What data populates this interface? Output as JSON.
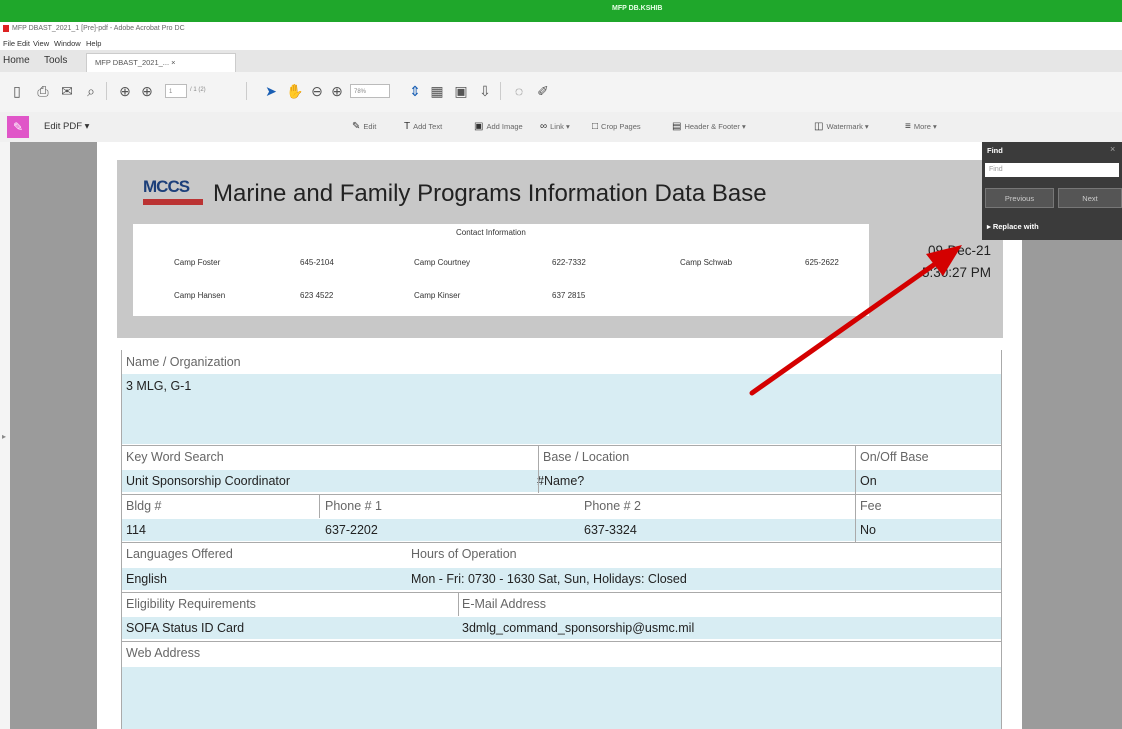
{
  "window": {
    "title_bar_text": "MFP DB.KSHIB",
    "app_title": "MFP DBAST_2021_1 [Pre]-pdf - Adobe Acrobat Pro DC"
  },
  "menu": [
    "File",
    "Edit",
    "View",
    "Window",
    "Help"
  ],
  "tabs": {
    "home": "Home",
    "tools": "Tools",
    "document": "MFP DBAST_2021_... ×"
  },
  "toolbar": {
    "page_box": "1",
    "page_total": "/ 1 (2)",
    "zoom": "78%"
  },
  "edit_pdf": {
    "label": "Edit PDF ▾",
    "tools": [
      {
        "icon": "✎",
        "label": "Edit"
      },
      {
        "icon": "T",
        "label": "Add Text"
      },
      {
        "icon": "▣",
        "label": "Add Image"
      },
      {
        "icon": "∞",
        "label": "Link ▾"
      },
      {
        "icon": "□",
        "label": "Crop Pages"
      },
      {
        "icon": "▤",
        "label": "Header & Footer ▾"
      },
      {
        "icon": "◫",
        "label": "Watermark ▾"
      },
      {
        "icon": "≡",
        "label": "More ▾"
      }
    ]
  },
  "find_panel": {
    "title": "Find",
    "close": "×",
    "placeholder": "Find",
    "previous": "Previous",
    "next": "Next",
    "replace_with": "▸ Replace with"
  },
  "form": {
    "logo_text": "MCCS",
    "title": "Marine and Family Programs Information Data Base",
    "date": "09-Dec-21",
    "time": "5:30:27 PM",
    "contact_title": "Contact Information",
    "contacts": [
      {
        "name": "Camp Foster",
        "phone": "645-2104"
      },
      {
        "name": "Camp Courtney",
        "phone": "622-7332"
      },
      {
        "name": "Camp Schwab",
        "phone": "625-2622"
      },
      {
        "name": "Camp Hansen",
        "phone": "623 4522"
      },
      {
        "name": "Camp Kinser",
        "phone": "637 2815"
      }
    ],
    "name_org_label": "Name / Organization",
    "name_org_value": "3 MLG, G-1",
    "keyword_label": "Key Word Search",
    "keyword_value": "Unit Sponsorship Coordinator",
    "base_label": "Base / Location",
    "base_value": "#Name?",
    "onoff_label": "On/Off Base",
    "onoff_value": "On",
    "bldg_label": "Bldg #",
    "bldg_value": "114",
    "phone1_label": "Phone # 1",
    "phone1_value": "637-2202",
    "phone2_label": "Phone # 2",
    "phone2_value": "637-3324",
    "fee_label": "Fee",
    "fee_value": "No",
    "languages_label": "Languages Offered",
    "languages_value": "English",
    "hours_label": "Hours of Operation",
    "hours_value": "Mon - Fri: 0730 - 1630  Sat, Sun, Holidays: Closed",
    "eligibility_label": "Eligibility Requirements",
    "eligibility_value": "SOFA Status ID Card",
    "email_label": "E-Mail Address",
    "email_value": "3dmlg_command_sponsorship@usmc.mil",
    "web_label": "Web Address",
    "web_value": ""
  },
  "colors": {
    "title_bar": "#1fa72b",
    "field_fill": "#d8edf3",
    "annotation_arrow": "#d40000",
    "find_panel": "#3b3b3b"
  }
}
